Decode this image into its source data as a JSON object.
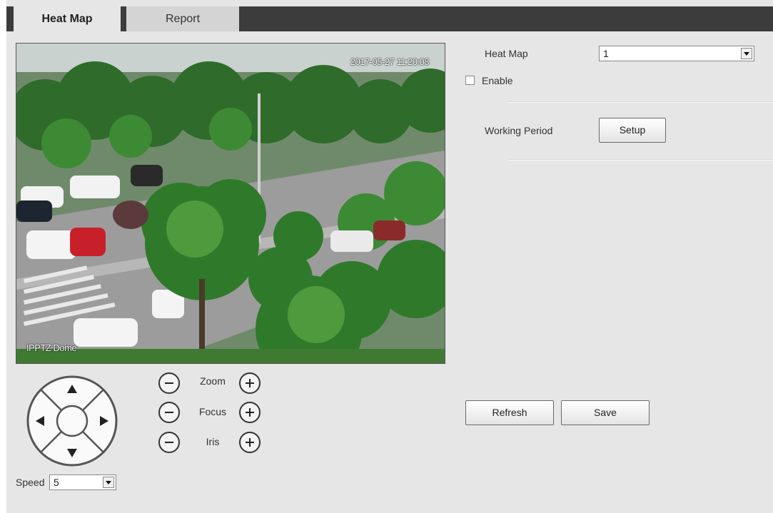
{
  "tabs": [
    {
      "label": "Heat Map",
      "active": true
    },
    {
      "label": "Report",
      "active": false
    }
  ],
  "video": {
    "timestamp": "2017-05-27 11:20:08",
    "channel_name": "IPPTZ Dome"
  },
  "ptz": {
    "icons": [
      "up-arrow-icon",
      "down-arrow-icon",
      "left-arrow-icon",
      "right-arrow-icon"
    ],
    "zoom_label": "Zoom",
    "focus_label": "Focus",
    "iris_label": "Iris",
    "speed_label": "Speed",
    "speed_value": "5"
  },
  "settings": {
    "heat_map_label": "Heat Map",
    "heat_map_value": "1",
    "enable_label": "Enable",
    "enable_checked": false,
    "working_period_label": "Working Period",
    "setup_label": "Setup"
  },
  "actions": {
    "refresh_label": "Refresh",
    "save_label": "Save"
  },
  "colors": {
    "tabbar": "#3c3c3c",
    "panel": "#e6e6e6"
  }
}
